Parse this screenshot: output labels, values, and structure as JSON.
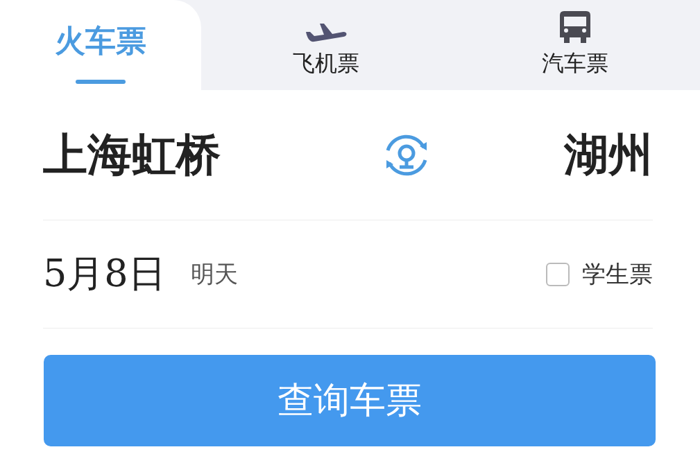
{
  "tabs": [
    {
      "label": "火车票",
      "kind": "train",
      "selected": true
    },
    {
      "label": "飞机票",
      "kind": "plane",
      "selected": false
    },
    {
      "label": "汽车票",
      "kind": "bus",
      "selected": false
    }
  ],
  "route": {
    "from": "上海虹桥",
    "to": "湖州"
  },
  "date": {
    "value": "5月8日",
    "hint": "明天"
  },
  "student": {
    "label": "学生票",
    "checked": false
  },
  "search_button": "查询车票"
}
